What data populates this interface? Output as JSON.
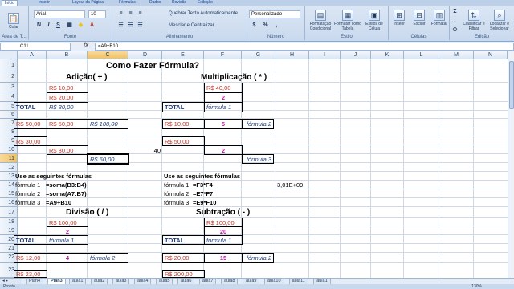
{
  "ribbon": {
    "tabs": [
      "Início",
      "Inserir",
      "Layout da Página",
      "Fórmulas",
      "Dados",
      "Revisão",
      "Exibição"
    ],
    "clipboard": {
      "paste": "Colar",
      "label": "Área de T..."
    },
    "font": {
      "name": "Arial",
      "size": "10",
      "bold": "N",
      "italic": "I",
      "underline": "S",
      "label": "Fonte"
    },
    "alignment": {
      "wrap": "Quebrar Texto Automaticamente",
      "merge": "Mesclar e Centralizar",
      "label": "Alinhamento"
    },
    "number": {
      "format": "Personalizado",
      "currency": "$",
      "percent": "%",
      "label": "Número"
    },
    "styles": {
      "cond": "Formatação Condicional",
      "table": "Formatar como Tabela",
      "cell": "Estilos de Célula",
      "label": "Estilo"
    },
    "cells": {
      "insert": "Inserir",
      "delete": "Excluir",
      "format": "Formatar",
      "label": "Células"
    },
    "editing": {
      "sort": "Classificar e Filtrar",
      "find": "Localizar e Selecionar",
      "label": "Edição"
    }
  },
  "formula_bar": {
    "name_box": "C11",
    "fx": "fx",
    "formula": "=A9+B10"
  },
  "columns": [
    "A",
    "B",
    "C",
    "D",
    "E",
    "F",
    "G",
    "H",
    "I",
    "J",
    "K",
    "L",
    "M",
    "N"
  ],
  "rows": [
    "1",
    "2",
    "3",
    "4",
    "5",
    "6",
    "7",
    "8",
    "9",
    "10",
    "11",
    "12",
    "13",
    "14",
    "15",
    "16",
    "17",
    "18",
    "19",
    "20",
    "21",
    "22",
    "23"
  ],
  "cells": {
    "title": "Como Fazer Fórmula?",
    "h_add": "Adição( + )",
    "h_mul": "Multiplicação ( * )",
    "h_div": "Divisão ( / )",
    "h_sub": "Subtração ( - )",
    "b3": "R$     10,00",
    "b4": "R$     20,00",
    "a5": "TOTAL",
    "b5": "R$     30,00",
    "f3": "R$     40,00",
    "f4": "2",
    "e5": "TOTAL",
    "f5": "fórmula 1",
    "a7": "R$ 50,00",
    "b7": "R$     50,00",
    "c7": "R$  100,00",
    "e7": "R$     10,00",
    "f7": "5",
    "g7": "fórmula 2",
    "a9": "R$ 30,00",
    "e9": "R$     50,00",
    "b10": "R$     30,00",
    "d10": "40",
    "f10": "2",
    "c11": "R$    60,00",
    "g11": "fórmula 3",
    "a13": "Use as seguintes fórmulas",
    "e13": "Use as seguintes fórmulas",
    "a14": "fórmula 1",
    "b14": "=soma(B3:B4)",
    "e14": "fórmula 1",
    "f14": "=F3*F4",
    "h14": "3,01E+09",
    "a15": "fórmula 2",
    "b15": "=soma(A7:B7)",
    "e15": "fórmula 2",
    "f15": "=E7*F7",
    "a16": "fórmula 3",
    "b16": "=A9+B10",
    "e16": "fórmula 3",
    "f16": "=E9*F10",
    "b18": "R$   100,00",
    "b19": "2",
    "a20": "TOTAL",
    "b20": "fórmula 1",
    "f18": "R$   100,00",
    "f19": "20",
    "e20": "TOTAL",
    "f20": "fórmula 1",
    "a22": "R$ 12,00",
    "b22": "4",
    "c22": "fórmula 2",
    "e22": "R$     20,00",
    "f22": "15",
    "g22": "fórmula 2",
    "a23": "R$    23,00",
    "e23": "R$   200,00"
  },
  "sheet_tabs": [
    "Plan4",
    "Plan3",
    "aula1",
    "aula2",
    "aula3",
    "aula4",
    "aula5",
    "aula6",
    "aula7",
    "aula8",
    "aula9",
    "aula10",
    "aula11",
    "aula1"
  ],
  "active_tab": "Plan3",
  "status": {
    "ready": "Pronto",
    "zoom": "130%"
  },
  "colors": {
    "currency_red": "#c0392b",
    "formula_navy": "#1f3b7a",
    "result_magenta": "#b4209d",
    "selection": "#f1c15f"
  }
}
